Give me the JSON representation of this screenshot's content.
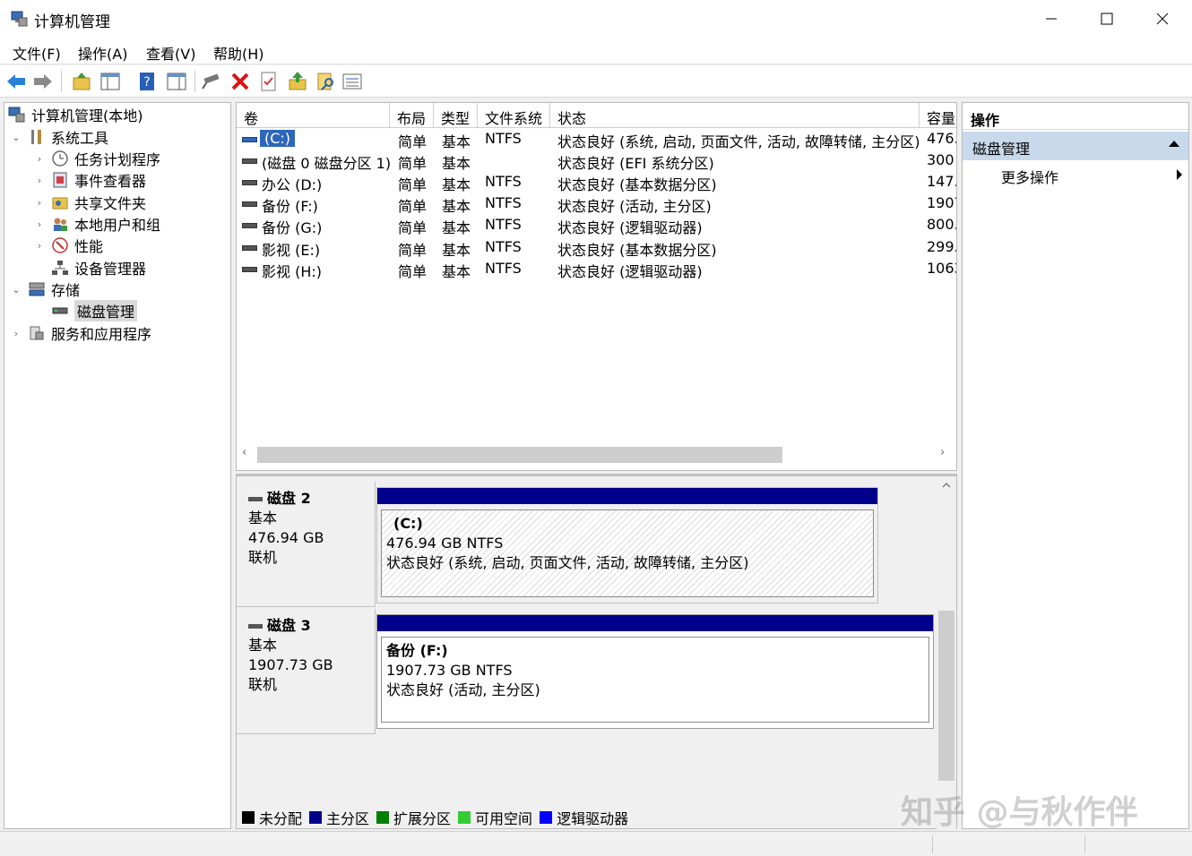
{
  "window": {
    "title": "计算机管理"
  },
  "menu": [
    "文件(F)",
    "操作(A)",
    "查看(V)",
    "帮助(H)"
  ],
  "tree": {
    "root": "计算机管理(本地)",
    "system_tools": "系统工具",
    "task_scheduler": "任务计划程序",
    "event_viewer": "事件查看器",
    "shared_folders": "共享文件夹",
    "local_users": "本地用户和组",
    "performance": "性能",
    "device_manager": "设备管理器",
    "storage": "存储",
    "disk_management": "磁盘管理",
    "services_apps": "服务和应用程序"
  },
  "volume_list": {
    "columns": [
      "卷",
      "布局",
      "类型",
      "文件系统",
      "状态",
      "容量"
    ],
    "rows": [
      {
        "vol": "(C:)",
        "layout": "简单",
        "type": "基本",
        "fs": "NTFS",
        "status": "状态良好 (系统, 启动, 页面文件, 活动, 故障转储, 主分区)",
        "cap": "476."
      },
      {
        "vol": "(磁盘 0 磁盘分区 1)",
        "layout": "简单",
        "type": "基本",
        "fs": "",
        "status": "状态良好 (EFI 系统分区)",
        "cap": "300"
      },
      {
        "vol": "办公 (D:)",
        "layout": "简单",
        "type": "基本",
        "fs": "NTFS",
        "status": "状态良好 (基本数据分区)",
        "cap": "147."
      },
      {
        "vol": "备份 (F:)",
        "layout": "简单",
        "type": "基本",
        "fs": "NTFS",
        "status": "状态良好 (活动, 主分区)",
        "cap": "1907"
      },
      {
        "vol": "备份 (G:)",
        "layout": "简单",
        "type": "基本",
        "fs": "NTFS",
        "status": "状态良好 (逻辑驱动器)",
        "cap": "800."
      },
      {
        "vol": "影视 (E:)",
        "layout": "简单",
        "type": "基本",
        "fs": "NTFS",
        "status": "状态良好 (基本数据分区)",
        "cap": "299."
      },
      {
        "vol": "影视 (H:)",
        "layout": "简单",
        "type": "基本",
        "fs": "NTFS",
        "status": "状态良好 (逻辑驱动器)",
        "cap": "1063"
      }
    ]
  },
  "disks": [
    {
      "name": "磁盘 2",
      "kind": "基本",
      "size": "476.94 GB",
      "state": "联机",
      "partition": {
        "name": "(C:)",
        "size": "476.94 GB NTFS",
        "status": "状态良好 (系统, 启动, 页面文件, 活动, 故障转储, 主分区)"
      }
    },
    {
      "name": "磁盘 3",
      "kind": "基本",
      "size": "1907.73 GB",
      "state": "联机",
      "partition": {
        "name": "备份  (F:)",
        "size": "1907.73 GB NTFS",
        "status": "状态良好 (活动, 主分区)"
      }
    }
  ],
  "legend": [
    {
      "label": "未分配",
      "color": "#000000"
    },
    {
      "label": "主分区",
      "color": "#00008b"
    },
    {
      "label": "扩展分区",
      "color": "#008000"
    },
    {
      "label": "可用空间",
      "color": "#33cc33"
    },
    {
      "label": "逻辑驱动器",
      "color": "#0000ff"
    }
  ],
  "actions": {
    "header": "操作",
    "section": "磁盘管理",
    "more": "更多操作"
  },
  "watermark": "知乎 @与秋作伴",
  "colors": {
    "selection": "#2d67b9",
    "primary_partition": "#00008b",
    "action_section": "#c9d9ec"
  }
}
